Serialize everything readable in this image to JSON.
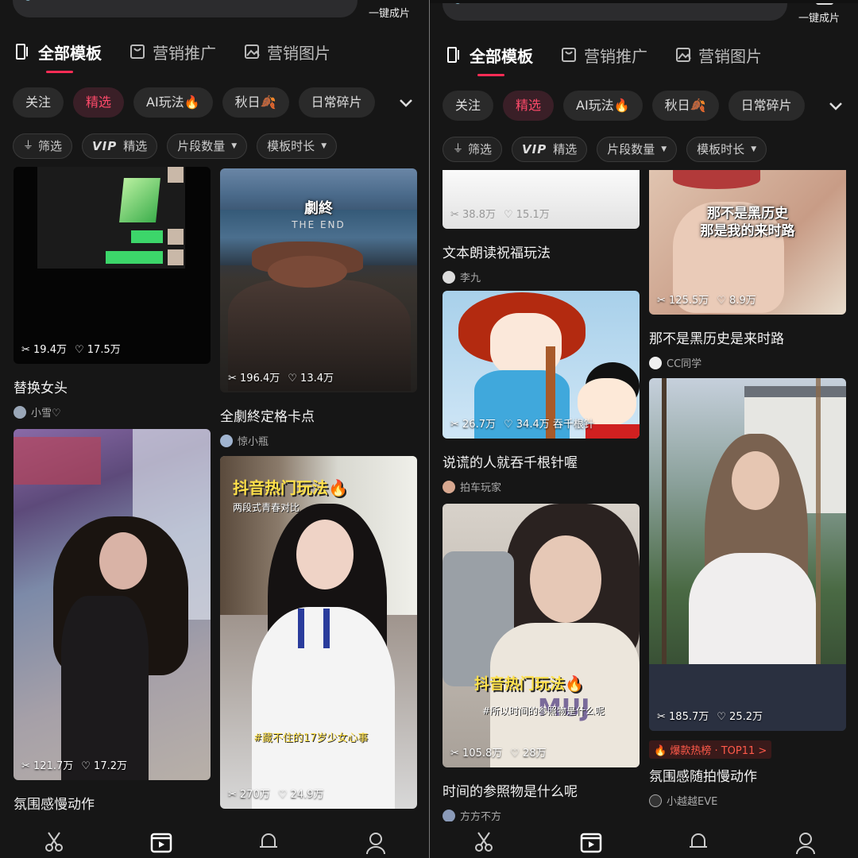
{
  "left": {
    "top_action": "一键成片",
    "tabs": [
      {
        "label": "全部模板"
      },
      {
        "label": "营销推广"
      },
      {
        "label": "营销图片"
      }
    ],
    "chips": [
      {
        "label": "关注"
      },
      {
        "label": "精选"
      },
      {
        "label": "AI玩法🔥"
      },
      {
        "label": "秋日🍂"
      },
      {
        "label": "日常碎片"
      }
    ],
    "filters": {
      "f0": "筛选",
      "vip": "VIP",
      "f1": "精选",
      "f2": "片段数量",
      "f3": "模板时长"
    },
    "cards": [
      {
        "title": "替换女头",
        "author": "小雪♡",
        "uses": "19.4万",
        "likes": "17.5万"
      },
      {
        "title": "全劇終定格卡点",
        "author": "惊小瓶",
        "uses": "196.4万",
        "likes": "13.4万",
        "overlay": "劇終",
        "overlay_sub": "THE END"
      },
      {
        "title": "氛围感慢动作",
        "author": "",
        "uses": "121.7万",
        "likes": "17.2万"
      },
      {
        "title": "",
        "author": "",
        "uses": "270万",
        "likes": "24.9万",
        "hot": "抖音热门玩法🔥",
        "hotsub": "两段式青春对比",
        "tag": "#藏不住的17岁少女心事"
      }
    ]
  },
  "right": {
    "top_action": "一键成片",
    "tabs": [
      {
        "label": "全部模板"
      },
      {
        "label": "营销推广"
      },
      {
        "label": "营销图片"
      }
    ],
    "chips": [
      {
        "label": "关注"
      },
      {
        "label": "精选"
      },
      {
        "label": "AI玩法🔥"
      },
      {
        "label": "秋日🍂"
      },
      {
        "label": "日常碎片"
      }
    ],
    "filters": {
      "f0": "筛选",
      "vip": "VIP",
      "f1": "精选",
      "f2": "片段数量",
      "f3": "模板时长"
    },
    "cards": [
      {
        "title": "文本朗读祝福玩法",
        "author": "李九",
        "uses": "38.8万",
        "likes": "15.1万"
      },
      {
        "title": "那不是黑历史是来时路",
        "author": "CC同学",
        "uses": "125.5万",
        "likes": "8.9万",
        "overlay": "那不是黑历史",
        "overlay2": "那是我的来时路"
      },
      {
        "title": "说谎的人就吞千根针喔",
        "author": "拍车玩家",
        "uses": "26.7万",
        "likes": "34.4万",
        "extra": "吞千根针"
      },
      {
        "title": "氛围感随拍慢动作",
        "author": "小越越EVE",
        "uses": "185.7万",
        "likes": "25.2万",
        "badge": "🔥 爆款热榜 · TOP11 >"
      },
      {
        "title": "时间的参照物是什么呢",
        "author": "方方不方",
        "uses": "105.8万",
        "likes": "28万",
        "hot": "抖音热门玩法🔥",
        "hotsub": "#所以时间的参照物是什么呢"
      }
    ]
  }
}
